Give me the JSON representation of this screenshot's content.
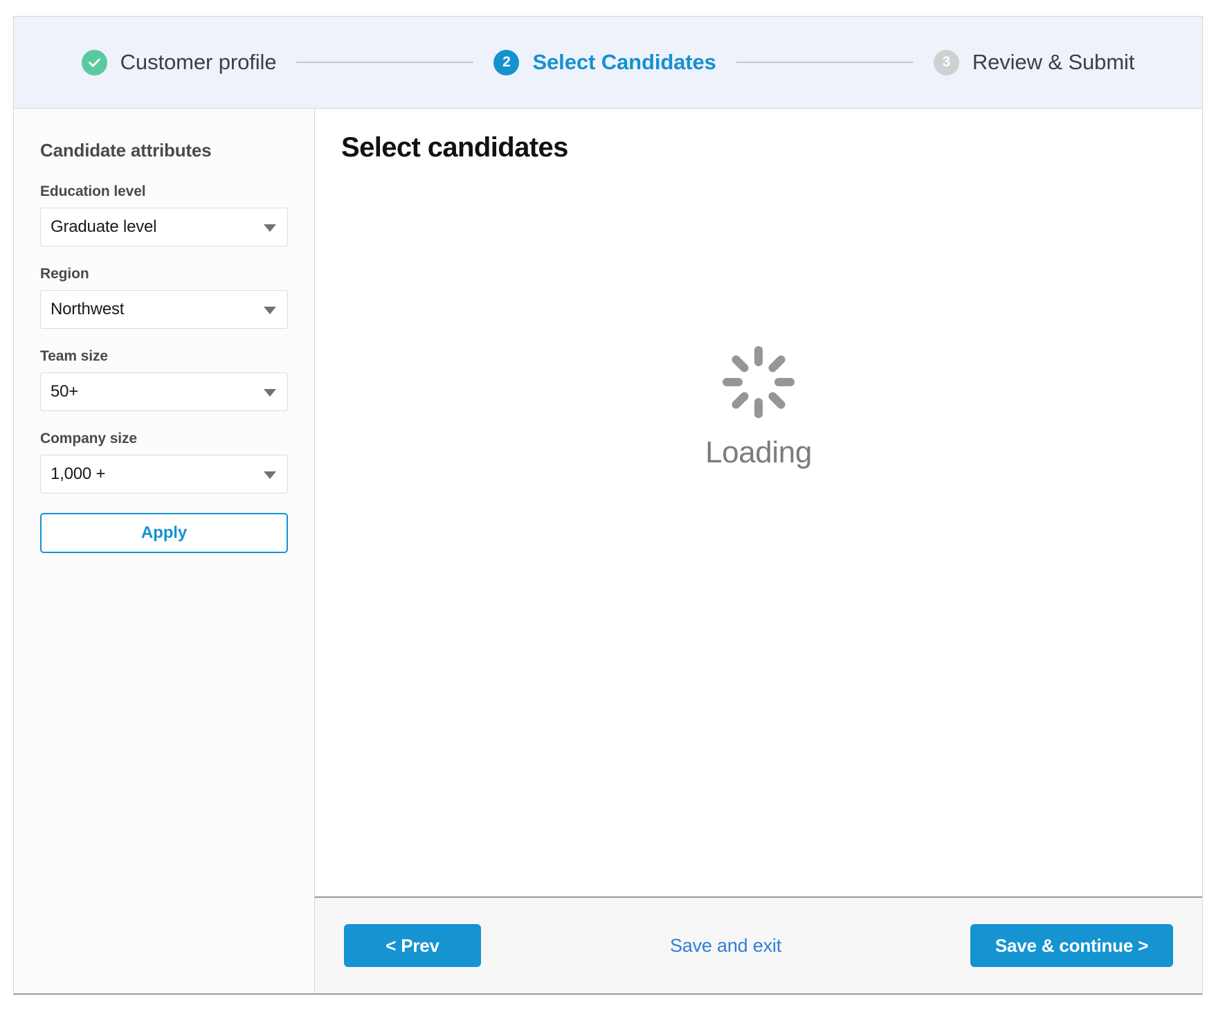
{
  "stepper": {
    "steps": [
      {
        "badge": "check-icon",
        "label": "Customer profile",
        "state": "done"
      },
      {
        "badge": "2",
        "label": "Select Candidates",
        "state": "current"
      },
      {
        "badge": "3",
        "label": "Review & Submit",
        "state": "todo"
      }
    ]
  },
  "sidebar": {
    "title": "Candidate attributes",
    "fields": [
      {
        "label": "Education level",
        "value": "Graduate level"
      },
      {
        "label": "Region",
        "value": "Northwest"
      },
      {
        "label": "Team size",
        "value": "50+"
      },
      {
        "label": "Company size",
        "value": "1,000 +"
      }
    ],
    "apply_label": "Apply"
  },
  "main": {
    "title": "Select candidates",
    "loading_text": "Loading",
    "spinner_icon": "loading-spinner-icon"
  },
  "footer": {
    "prev_label": "< Prev",
    "save_exit_label": "Save and exit",
    "continue_label": "Save & continue >"
  },
  "colors": {
    "accent": "#1591cf",
    "success": "#5bc9a0",
    "muted": "#cfd0d2",
    "link": "#2f7fd6",
    "header_bg": "#eef2fb",
    "spinner": "#969696"
  }
}
